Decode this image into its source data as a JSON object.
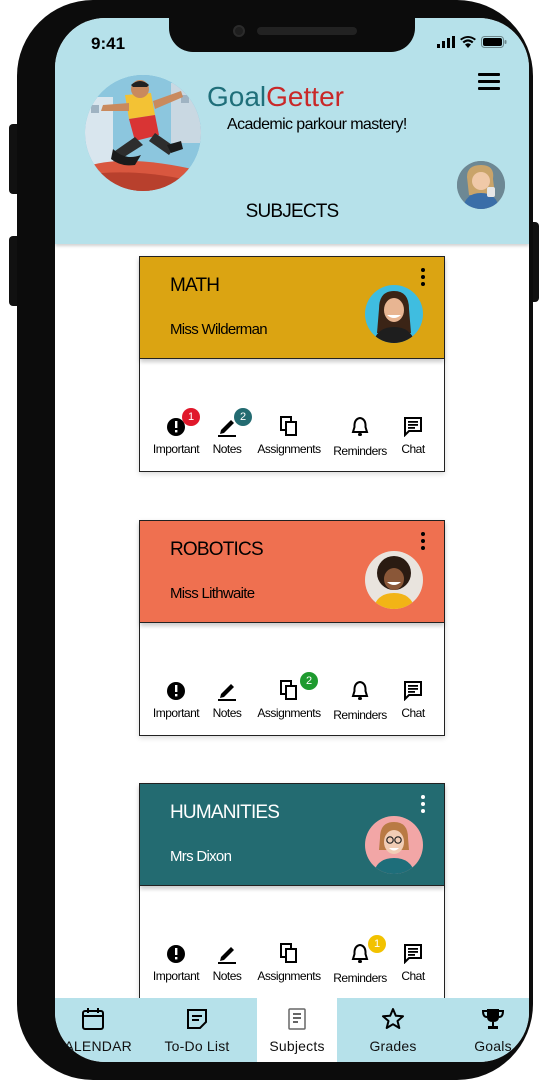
{
  "status": {
    "time": "9:41"
  },
  "app": {
    "name_part1": "Goal",
    "name_part2": "Getter",
    "tagline": "Academic parkour mastery!",
    "section_title": "SUBJECTS"
  },
  "subjects": [
    {
      "name": "MATH",
      "teacher": "Miss Wilderman",
      "color": "#dba412",
      "badges": {
        "important": "1",
        "notes": "2"
      },
      "actions": [
        "Important",
        "Notes",
        "Assignments",
        "Reminders",
        "Chat"
      ]
    },
    {
      "name": "ROBOTICS",
      "teacher": "Miss Lithwaite",
      "color": "#ef7050",
      "badges": {
        "assignments": "2"
      },
      "actions": [
        "Important",
        "Notes",
        "Assignments",
        "Reminders",
        "Chat"
      ]
    },
    {
      "name": "HUMANITIES",
      "teacher": "Mrs Dixon",
      "color": "#236b71",
      "badges": {
        "reminders": "1"
      },
      "actions": [
        "Important",
        "Notes",
        "Assignments",
        "Reminders",
        "Chat"
      ]
    }
  ],
  "badge_colors": {
    "important": "#e0182b",
    "notes": "#236b71",
    "assignments": "#1e9a2f",
    "reminders": "#f2c200"
  },
  "nav": [
    {
      "label": "CALENDAR",
      "icon": "calendar-icon"
    },
    {
      "label": "To-Do List",
      "icon": "todo-list-icon"
    },
    {
      "label": "Subjects",
      "icon": "subjects-icon",
      "active": true
    },
    {
      "label": "Grades",
      "icon": "star-icon"
    },
    {
      "label": "Goals",
      "icon": "trophy-icon"
    }
  ]
}
